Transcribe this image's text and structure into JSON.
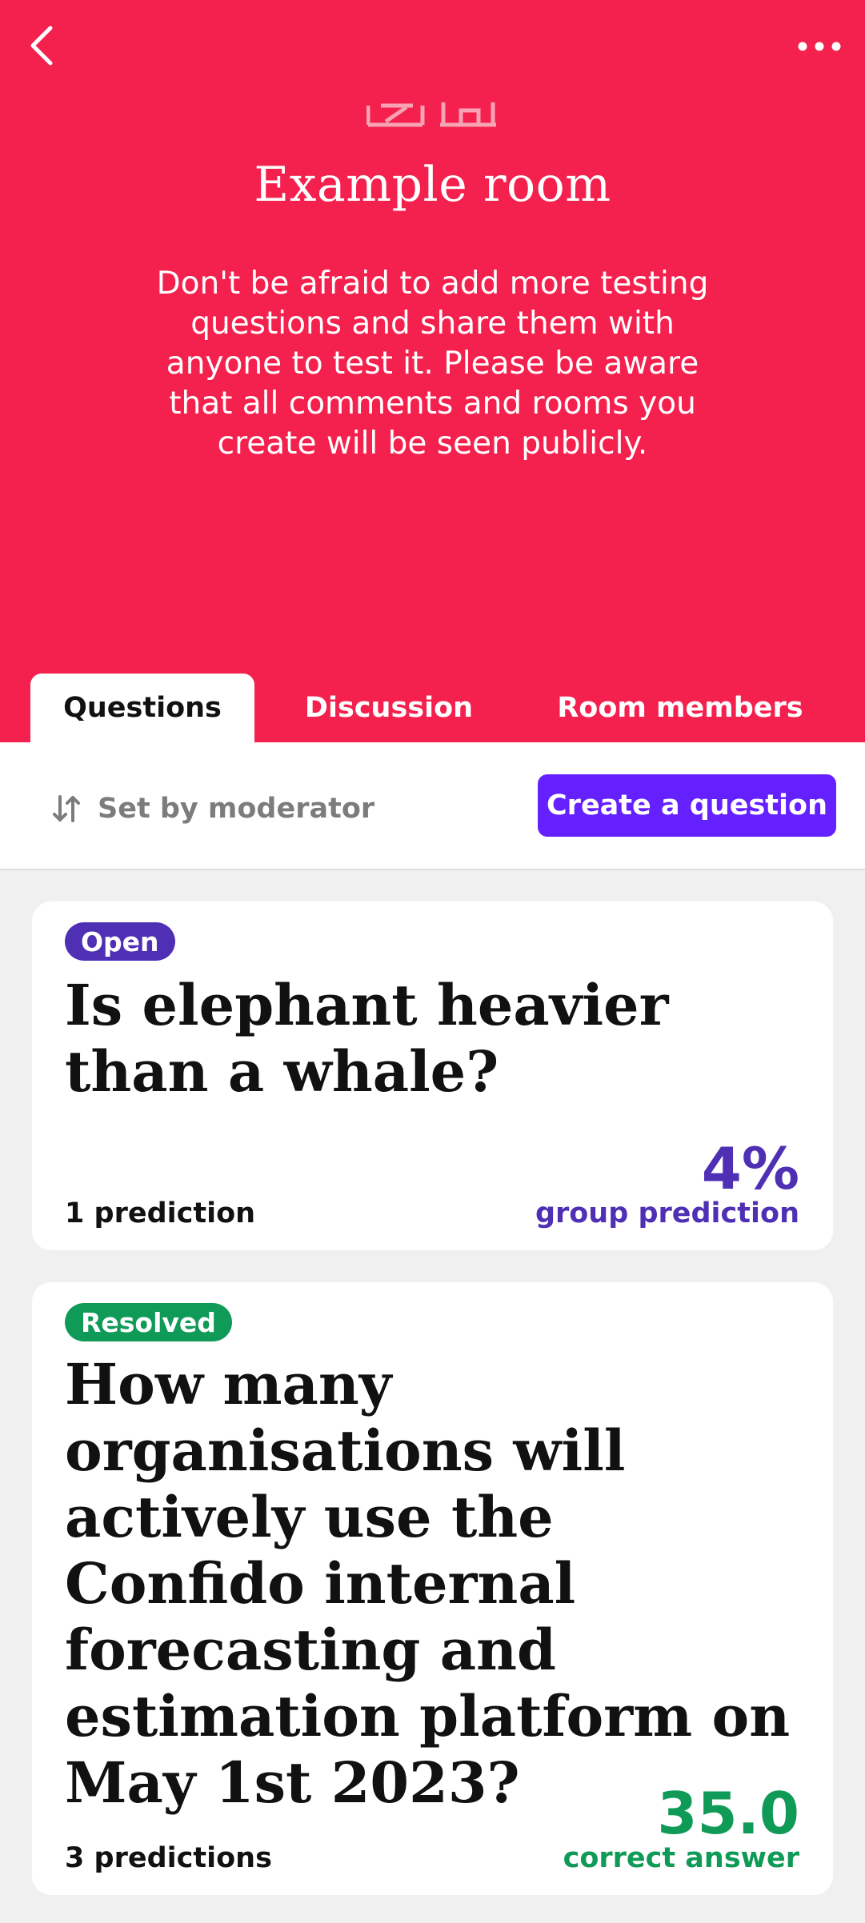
{
  "colors": {
    "header_bg": "#f4204d",
    "primary_button": "#6520ff",
    "open_badge": "#4f30b5",
    "resolved_badge": "#109a57",
    "page_bg": "#f0f0f0"
  },
  "header": {
    "back_icon": "chevron-left-icon",
    "more_icon": "more-horizontal-icon",
    "room_title": "Example room",
    "room_description": "Don't be afraid to add more testing questions and share them with anyone to test it. Please be aware that all comments and rooms you create will be seen publicly."
  },
  "tabs": [
    {
      "label": "Questions",
      "active": true
    },
    {
      "label": "Discussion",
      "active": false
    },
    {
      "label": "Room members",
      "active": false
    }
  ],
  "toolbar": {
    "sort_icon": "sort-arrows-icon",
    "sort_label": "Set by moderator",
    "create_label": "Create a question"
  },
  "questions": [
    {
      "status": "Open",
      "title": "Is elephant heavier than a whale?",
      "predictions": "1 prediction",
      "value": "4%",
      "value_caption": "group prediction"
    },
    {
      "status": "Resolved",
      "title": "How many organisations will actively use the Confido internal forecasting and estimation platform on May 1st 2023?",
      "predictions": "3 predictions",
      "value": "35.0",
      "value_caption": "correct answer"
    }
  ]
}
